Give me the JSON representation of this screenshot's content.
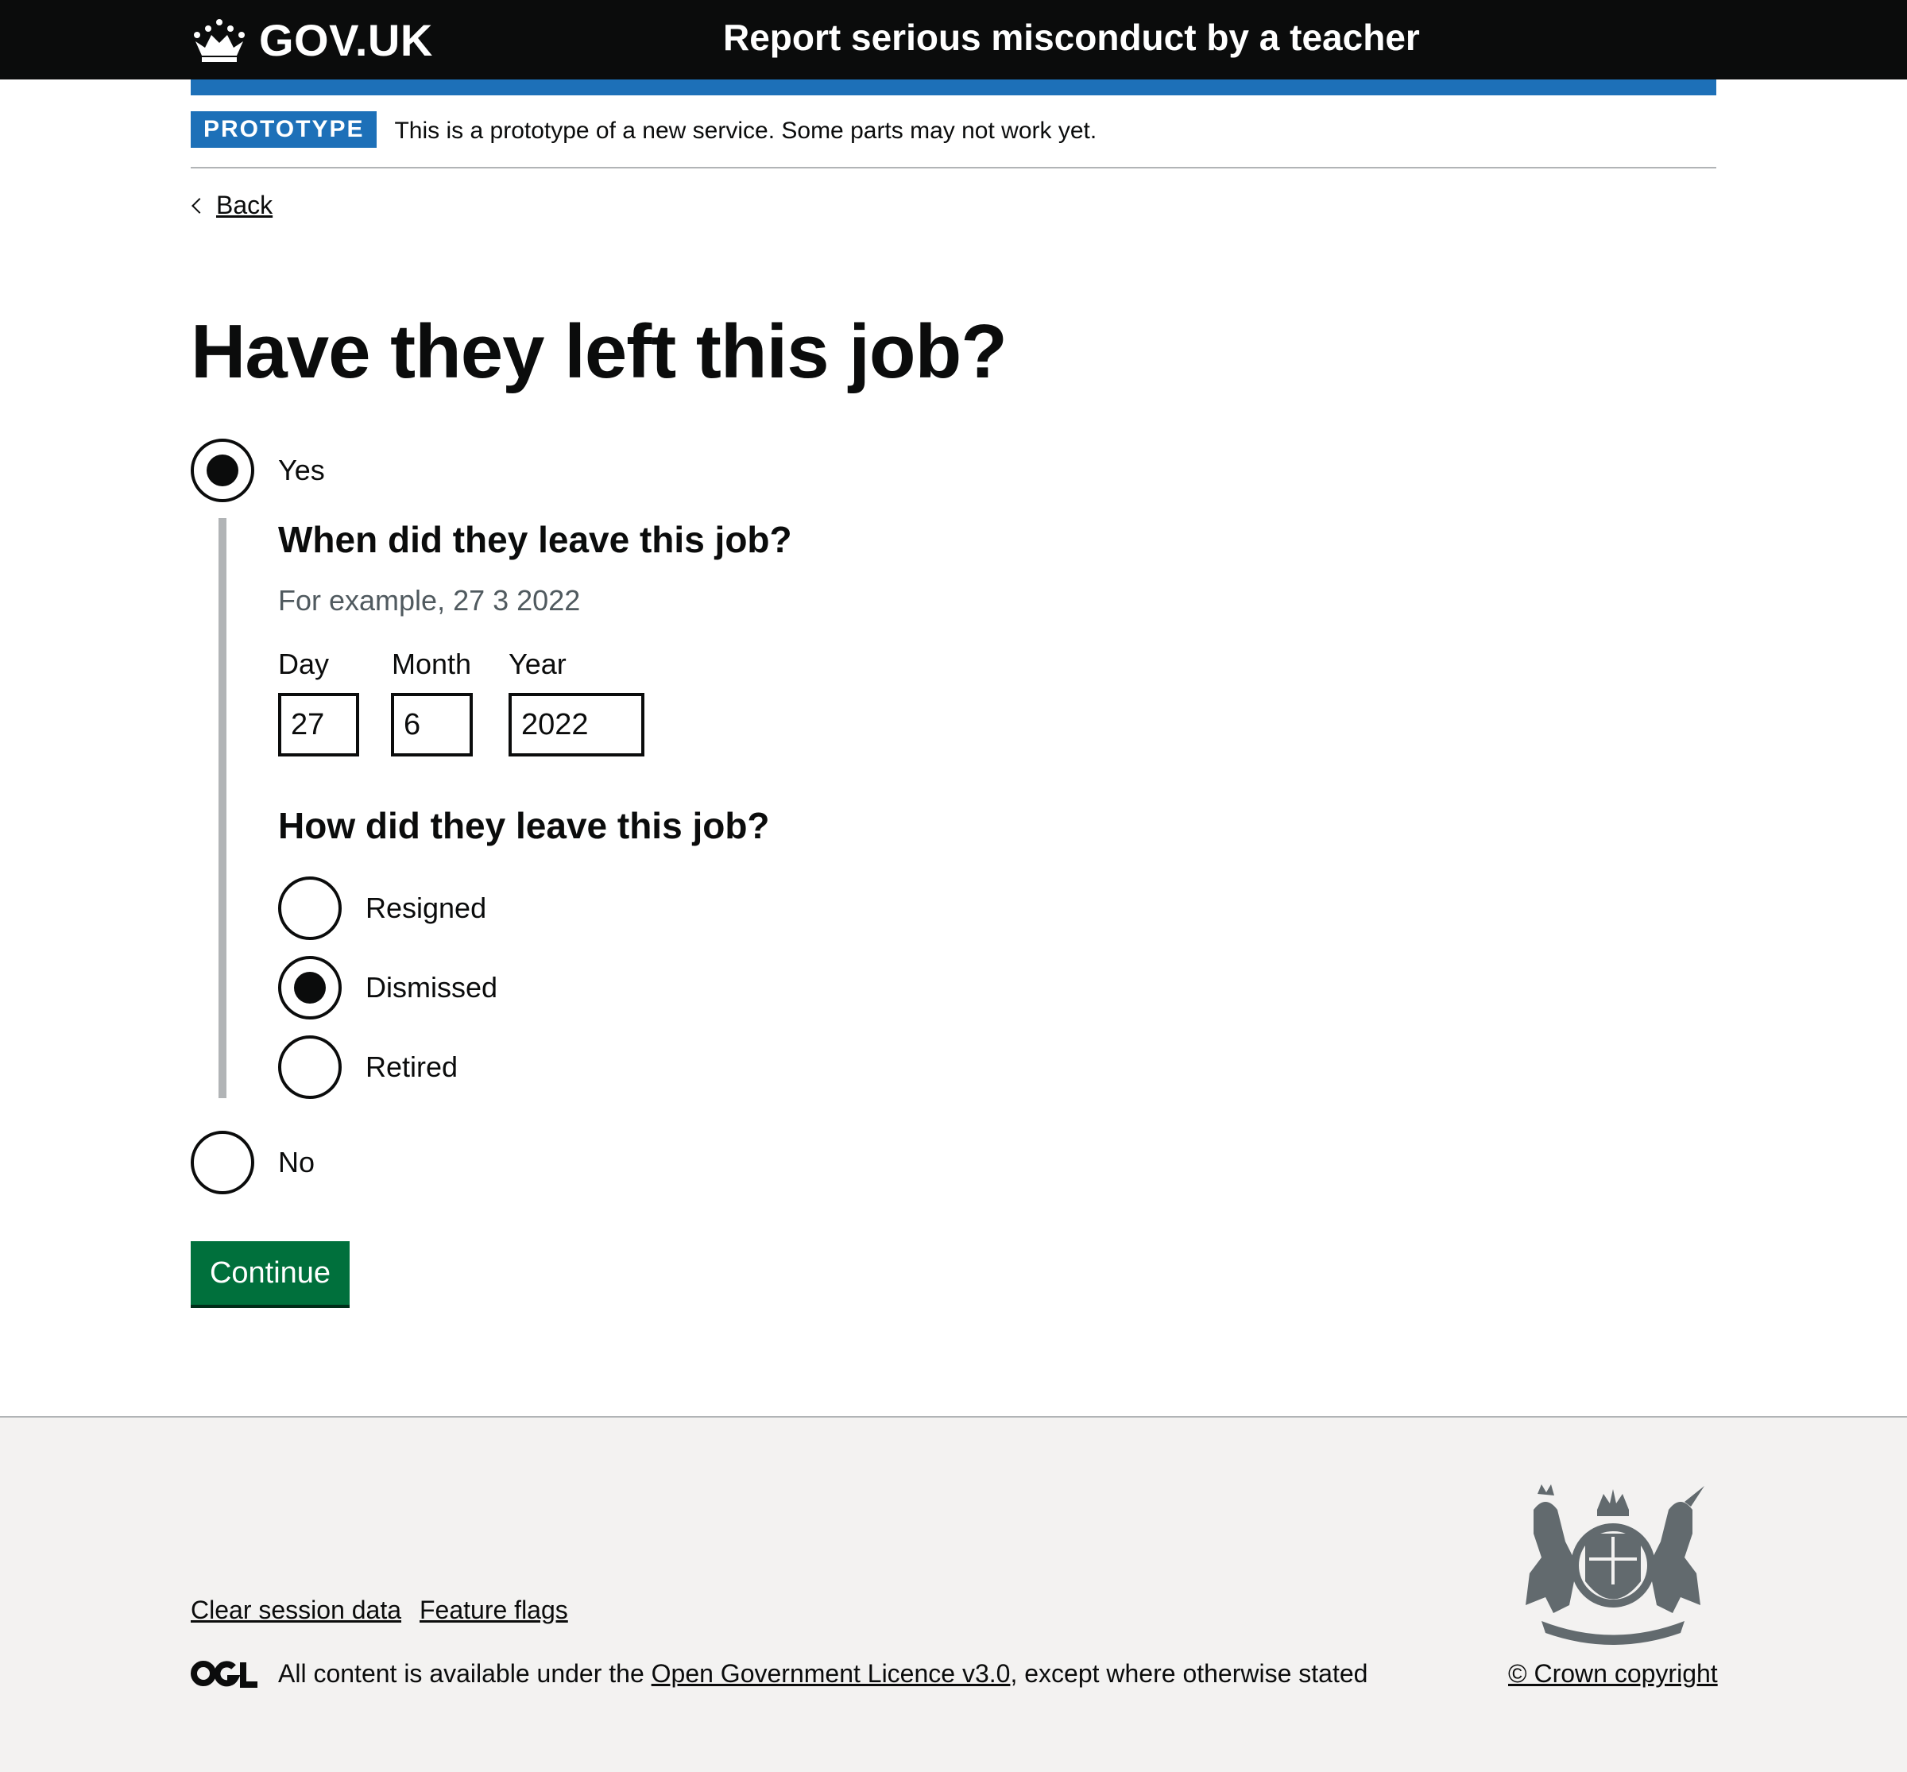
{
  "header": {
    "logo_text": "GOV.UK",
    "service_name": "Report serious misconduct by a teacher"
  },
  "phase_banner": {
    "tag": "PROTOTYPE",
    "text": "This is a prototype of a new service. Some parts may not work yet."
  },
  "back_link": "Back",
  "main": {
    "heading": "Have they left this job?",
    "options": [
      {
        "label": "Yes",
        "checked": true
      },
      {
        "label": "No",
        "checked": false
      }
    ],
    "conditional": {
      "date_question": "When did they leave this job?",
      "date_hint": "For example, 27 3 2022",
      "date_fields": [
        {
          "label": "Day",
          "value": "27"
        },
        {
          "label": "Month",
          "value": "6"
        },
        {
          "label": "Year",
          "value": "2022"
        }
      ],
      "leave_question": "How did they leave this job?",
      "leave_options": [
        {
          "label": "Resigned",
          "checked": false
        },
        {
          "label": "Dismissed",
          "checked": true
        },
        {
          "label": "Retired",
          "checked": false
        }
      ]
    },
    "continue_button": "Continue"
  },
  "footer": {
    "links": [
      "Clear session data",
      "Feature flags"
    ],
    "ogl_logo": "OGL",
    "licence_prefix": "All content is available under the ",
    "licence_link": "Open Government Licence v3.0",
    "licence_suffix": ", except where otherwise stated",
    "copyright": "© Crown copyright"
  },
  "colors": {
    "header_bg": "#0b0c0c",
    "brand_blue": "#1d70b8",
    "button_green": "#00703c",
    "footer_bg": "#f3f2f1",
    "hint_grey": "#505a5f"
  },
  "icons": [
    "crown-icon",
    "chevron-left-icon",
    "ogl-logo",
    "royal-coat-of-arms-icon"
  ]
}
